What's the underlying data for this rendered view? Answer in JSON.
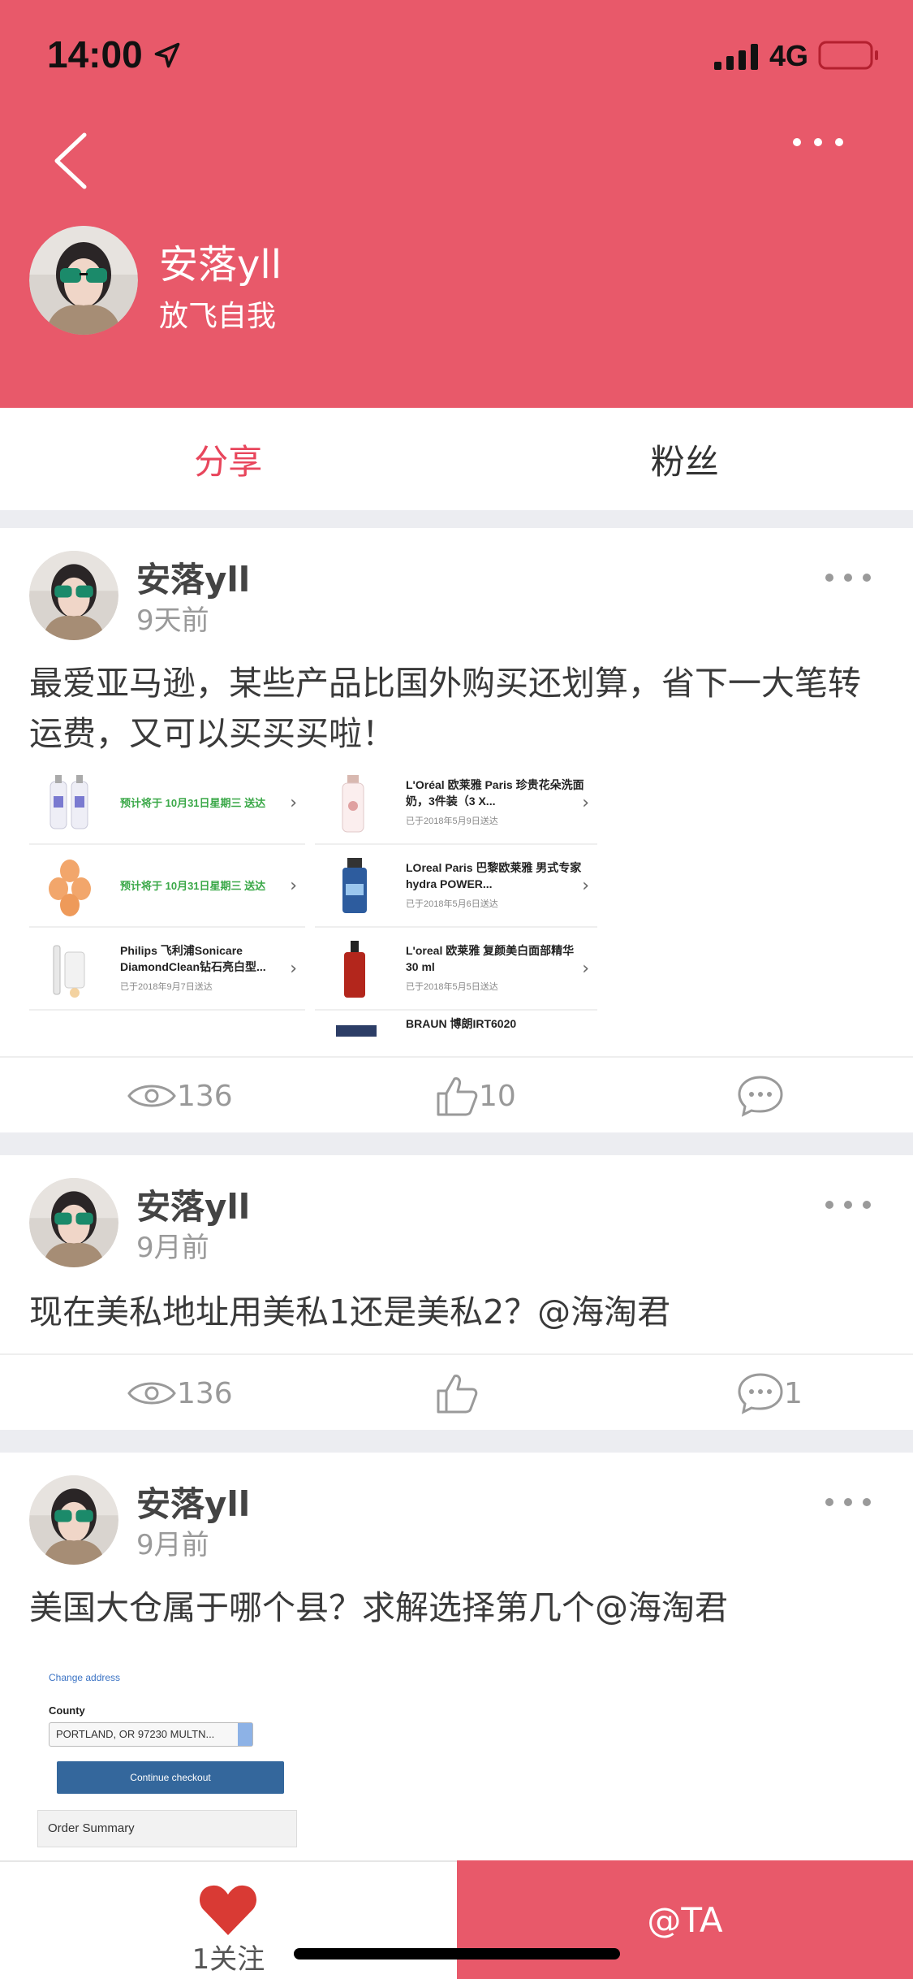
{
  "status_bar": {
    "time": "14:00",
    "network": "4G"
  },
  "profile": {
    "name": "安落yll",
    "signature": "放飞自我"
  },
  "tabs": [
    {
      "label": "分享",
      "active": true
    },
    {
      "label": "粉丝",
      "active": false
    }
  ],
  "posts": [
    {
      "author": "安落yll",
      "time": "9天前",
      "text": "最爱亚马逊，某些产品比国外购买还划算，省下一大笔转运费，又可以买买买啦！",
      "views": "136",
      "likes": "10",
      "comments": "",
      "image_orders": {
        "left": [
          {
            "green": "预计将于 10月31日星期三 送达"
          },
          {
            "green": "预计将于 10月31日星期三 送达"
          },
          {
            "title": "Philips 飞利浦Sonicare DiamondClean钻石亮白型...",
            "sub": "已于2018年9月7日送达"
          }
        ],
        "right": [
          {
            "title": "L'Oréal 欧莱雅 Paris 珍贵花朵洗面奶，3件装（3 X...",
            "sub": "已于2018年5月9日送达"
          },
          {
            "title": "LOreal Paris 巴黎欧莱雅 男式专家 hydra POWER...",
            "sub": "已于2018年5月6日送达"
          },
          {
            "title": "L'oreal 欧莱雅 复颜美白面部精华 30 ml",
            "sub": "已于2018年5月5日送达"
          },
          {
            "title": "BRAUN 博朗IRT6020",
            "sub": ""
          }
        ]
      }
    },
    {
      "author": "安落yll",
      "time": "9月前",
      "text": "现在美私地址用美私1还是美私2？@海淘君",
      "views": "136",
      "likes": "",
      "comments": "1"
    },
    {
      "author": "安落yll",
      "time": "9月前",
      "text": "美国大仓属于哪个县？求解选择第几个@海淘君",
      "image_checkout": {
        "link": "Change address",
        "county_label": "County",
        "county_value": "PORTLAND, OR 97230 MULTN...",
        "button": "Continue checkout",
        "summary": "Order Summary"
      }
    }
  ],
  "bottom": {
    "follow_label": "1关注",
    "at_button": "@TA"
  },
  "colors": {
    "brand": "#e8596a",
    "active_tab": "#e8465c",
    "muted": "#999999"
  }
}
